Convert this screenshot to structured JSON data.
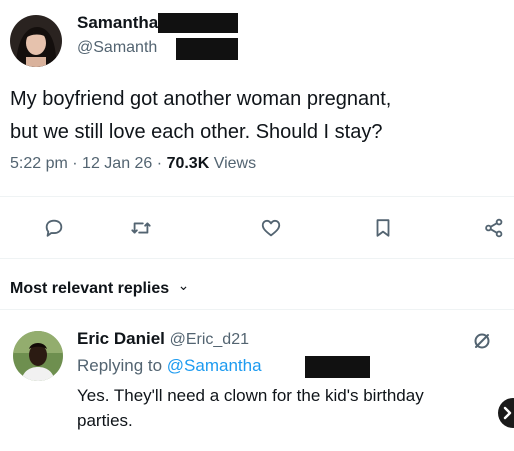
{
  "tweet": {
    "author_name": "Samantha",
    "author_handle": "@Samanth",
    "text_line1": "My boyfriend got another woman pregnant,",
    "text_line2": "but we still love each other. Should I stay?",
    "time": "5:22 pm",
    "sep1": "·",
    "date": "12 Jan 26",
    "sep2": "·",
    "views_count": "70.3K",
    "views_label": "Views"
  },
  "actions": [
    "reply-icon",
    "retweet-icon",
    "like-icon",
    "bookmark-icon",
    "share-icon"
  ],
  "replies_header": {
    "label": "Most relevant replies",
    "chevron": "⌄"
  },
  "reply": {
    "author_name": "Eric Daniel",
    "author_handle": "@Eric_d21",
    "replying_to_label": "Replying to",
    "replying_to_handle": "@Samantha",
    "text_line1": "Yes. They'll need a clown for the kid's birthday",
    "text_line2": "parties."
  },
  "colors": {
    "accent": "#1d9bf0",
    "muted": "#536471",
    "text": "#0f1419"
  }
}
